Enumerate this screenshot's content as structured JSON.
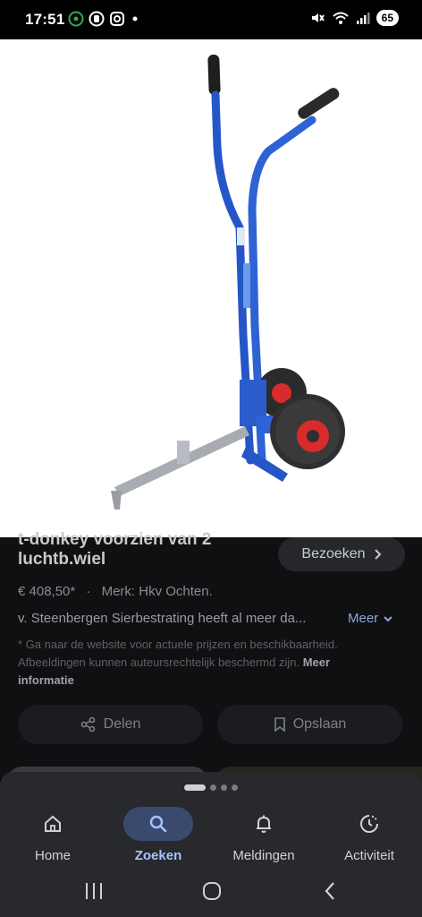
{
  "status_bar": {
    "time": "17:51",
    "battery": "65",
    "left_icons": [
      "podcast-icon",
      "whatsapp-icon",
      "instagram-icon",
      "dot-icon"
    ],
    "right_icons": [
      "mute-icon",
      "wifi-icon",
      "signal-icon"
    ]
  },
  "result": {
    "title_line1": "t-donkey voorzien van 2",
    "title_line2": "luchtb.wiel",
    "visit_label": "Bezoeken",
    "price": "€ 408,50*",
    "separator": "·",
    "brand": "Merk: Hkv Ochten.",
    "description": "v. Steenbergen Sierbestrating heeft al meer da...",
    "more_label": "Meer",
    "disclaimer": "* Ga naar de website voor actuele prijzen en beschikbaarheid. Afbeeldingen kunnen auteursrechtelijk beschermd zijn.",
    "disclaimer_link": "Meer informatie",
    "share_label": "Delen",
    "save_label": "Opslaan"
  },
  "bottom_nav": {
    "items": [
      {
        "label": "Home",
        "icon": "home-icon"
      },
      {
        "label": "Zoeken",
        "icon": "search-icon",
        "active": true
      },
      {
        "label": "Meldingen",
        "icon": "bell-icon"
      },
      {
        "label": "Activiteit",
        "icon": "activity-icon"
      }
    ]
  },
  "colors": {
    "accent": "#a8c4ff",
    "trolley_blue": "#2456c8",
    "wheel_red": "#d92b2b"
  }
}
